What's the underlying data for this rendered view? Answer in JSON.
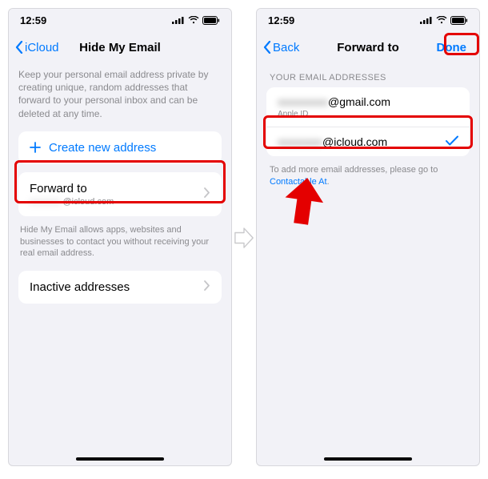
{
  "status": {
    "time": "12:59"
  },
  "left": {
    "nav_back": "iCloud",
    "nav_title": "Hide My Email",
    "desc": "Keep your personal email address private by creating unique, random addresses that forward to your personal inbox and can be deleted at any time.",
    "create_label": "Create new address",
    "forward_label": "Forward to",
    "forward_value_blur": "xxxxxxx",
    "forward_value_after": "@icloud.com",
    "helper": "Hide My Email allows apps, websites and businesses to contact you without receiving your real email address.",
    "inactive_label": "Inactive addresses"
  },
  "right": {
    "nav_back": "Back",
    "nav_title": "Forward to",
    "nav_done": "Done",
    "section_header": "YOUR EMAIL ADDRESSES",
    "emails": [
      {
        "blur": "xxxxxxxxx",
        "after": "@gmail.com",
        "sub": "Apple ID",
        "selected": false
      },
      {
        "blur": "xxxxxxxx",
        "after": "@icloud.com",
        "sub": "",
        "selected": true
      }
    ],
    "foot_pre": "To add more email addresses, please go to ",
    "foot_link": "Contactable At",
    "foot_post": "."
  }
}
